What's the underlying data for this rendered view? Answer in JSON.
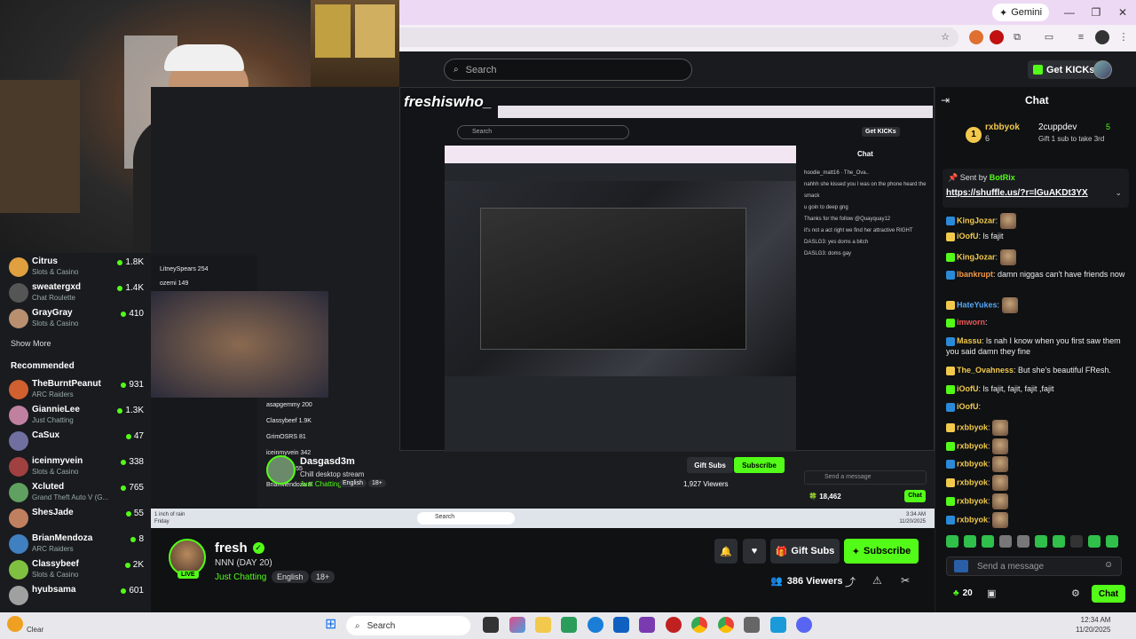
{
  "browser": {
    "gemini_label": "Gemini",
    "minimize": "—",
    "maximize": "❐",
    "close": "✕"
  },
  "header": {
    "search_placeholder": "Search",
    "get_kicks": "Get KICKs"
  },
  "sidebar": {
    "following": [
      {
        "name": "Citrus",
        "category": "Slots & Casino",
        "count": "1.8K",
        "color": "#e0a040"
      },
      {
        "name": "sweatergxd",
        "category": "Chat Roulette",
        "count": "1.4K",
        "color": "#555"
      },
      {
        "name": "GrayGray",
        "category": "Slots & Casino",
        "count": "410",
        "color": "#b89070"
      }
    ],
    "show_more": "Show More",
    "recommended_label": "Recommended",
    "recommended": [
      {
        "name": "TheBurntPeanut",
        "category": "ARC Raiders",
        "count": "931",
        "color": "#d06030"
      },
      {
        "name": "GiannieLee",
        "category": "Just Chatting",
        "count": "1.3K",
        "color": "#c080a0"
      },
      {
        "name": "CaSux",
        "category": "",
        "count": "47",
        "color": "#7070a0"
      },
      {
        "name": "iceinmyvein",
        "category": "Slots & Casino",
        "count": "338",
        "color": "#a04040"
      },
      {
        "name": "Xcluted",
        "category": "Grand Theft Auto V (G...",
        "count": "765",
        "color": "#60a060"
      },
      {
        "name": "ShesJade",
        "category": "",
        "count": "55",
        "color": "#c08060"
      },
      {
        "name": "BrianMendoza",
        "category": "ARC Raiders",
        "count": "8",
        "color": "#4080c0"
      },
      {
        "name": "Classybeef",
        "category": "Slots & Casino",
        "count": "2K",
        "color": "#80c040"
      },
      {
        "name": "hyubsama",
        "category": "",
        "count": "601",
        "color": "#a0a0a0"
      }
    ]
  },
  "stream": {
    "name": "fresh",
    "title": "NNN (DAY 20)",
    "category": "Just Chatting",
    "tags": [
      "English",
      "18+"
    ],
    "live": "LIVE",
    "gift_subs": "Gift Subs",
    "subscribe": "Subscribe",
    "viewers": "386 Viewers"
  },
  "nested": {
    "streamer": "Dasgasd3m",
    "title": "Chill desktop stream",
    "category": "Just Chatting",
    "tags": [
      "English",
      "18+"
    ],
    "viewers": "1,927 Viewers",
    "gift_subs": "Gift Subs",
    "subscribe": "Subscribe",
    "watermark": "freshiswho_",
    "search": "Search",
    "get_kicks": "Get KICKs",
    "chat_title": "Chat",
    "send_placeholder": "Send a message",
    "points": "18,462",
    "chat_btn": "Chat",
    "taskbar_search": "Search",
    "clock_time": "3:34 AM",
    "clock_date": "11/20/2025",
    "weather": "1 inch of rain",
    "weather_day": "Friday"
  },
  "chat": {
    "title": "Chat",
    "leader": {
      "rank": "1",
      "user1": "rxbbyok",
      "count1": "6",
      "user2": "2cuppdev",
      "count2": "5",
      "gift_note": "Gift 1 sub to take 3rd"
    },
    "pinned": {
      "sent_by_label": "Sent by",
      "sender": "BotRix",
      "link": "https://shuffle.us/?r=lGuAKDt3YX"
    },
    "messages": [
      {
        "user": "KingJozar",
        "text": "",
        "color": "#f2c94c",
        "emote": true
      },
      {
        "user": "iOofU",
        "text": "ls fajit",
        "color": "#f2c94c",
        "emote": false
      },
      {
        "user": "KingJozar",
        "text": "",
        "color": "#f2c94c",
        "emote": true
      },
      {
        "user": "lbankrupt",
        "text": "damn niggas can't have friends now",
        "color": "#f2994a",
        "emote": false
      },
      {
        "user": "HateYukes",
        "text": "",
        "color": "#56a8f5",
        "emote": true
      },
      {
        "user": "imworn",
        "text": "",
        "color": "#eb5757",
        "emote": false
      },
      {
        "user": "Massu",
        "text": "ls nah I know when you first saw them you said damn they fine",
        "color": "#f2c94c",
        "emote": false
      },
      {
        "user": "The_Ovahness",
        "text": "But she's beautiful FResh.",
        "color": "#f2c94c",
        "emote": false
      },
      {
        "user": "iOofU",
        "text": "ls fajit, fajit, fajit ,fajit",
        "color": "#f2c94c",
        "emote": false
      },
      {
        "user": "iOofU",
        "text": "",
        "color": "#f2c94c",
        "emote": false
      },
      {
        "user": "rxbbyok",
        "text": "",
        "color": "#f2c94c",
        "emote": true
      },
      {
        "user": "rxbbyok",
        "text": "",
        "color": "#f2c94c",
        "emote": true
      },
      {
        "user": "rxbbyok",
        "text": "",
        "color": "#f2c94c",
        "emote": true
      },
      {
        "user": "rxbbyok",
        "text": "",
        "color": "#f2c94c",
        "emote": true
      },
      {
        "user": "rxbbyok",
        "text": "",
        "color": "#f2c94c",
        "emote": true
      },
      {
        "user": "rxbbyok",
        "text": "",
        "color": "#f2c94c",
        "emote": true
      }
    ],
    "input_placeholder": "Send a message",
    "points": "20",
    "send_label": "Chat"
  },
  "taskbar": {
    "search": "Search",
    "weather_temp": "Clear",
    "time": "12:34 AM",
    "date": "11/20/2025"
  },
  "colors": {
    "kick_green": "#53fc18",
    "panel": "#191b1f",
    "bg": "#0f1113"
  }
}
